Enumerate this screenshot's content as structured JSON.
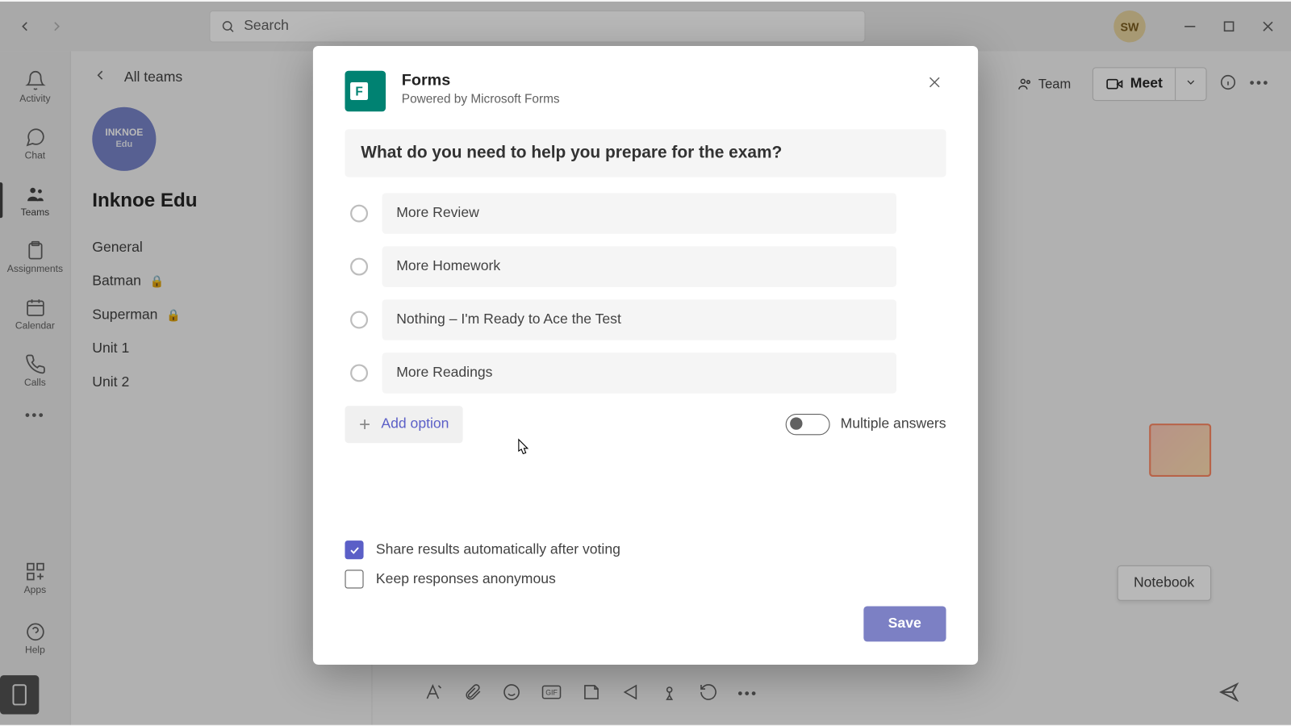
{
  "titlebar": {
    "search_placeholder": "Search",
    "avatar_initials": "SW"
  },
  "rail": {
    "activity": "Activity",
    "chat": "Chat",
    "teams": "Teams",
    "assignments": "Assignments",
    "calendar": "Calendar",
    "calls": "Calls",
    "apps": "Apps",
    "help": "Help"
  },
  "channels": {
    "back_label": "All teams",
    "team_logo_top": "INKNOE",
    "team_logo_sub": "Edu",
    "team_name": "Inknoe Edu",
    "items": [
      {
        "label": "General",
        "locked": false
      },
      {
        "label": "Batman",
        "locked": true
      },
      {
        "label": "Superman",
        "locked": true
      },
      {
        "label": "Unit 1",
        "locked": false
      },
      {
        "label": "Unit 2",
        "locked": false
      }
    ]
  },
  "header": {
    "team_btn": "Team",
    "meet_btn": "Meet"
  },
  "content": {
    "notebook_chip": "Notebook"
  },
  "modal": {
    "title": "Forms",
    "subtitle": "Powered by Microsoft Forms",
    "question": "What do you need to help you prepare for the exam?",
    "options": [
      "More Review",
      "More Homework",
      "Nothing – I'm Ready to Ace the Test",
      "More Readings"
    ],
    "add_option_label": "Add option",
    "multiple_answers_label": "Multiple answers",
    "share_results_label": "Share results automatically after voting",
    "anonymous_label": "Keep responses anonymous",
    "save_label": "Save",
    "share_results_checked": true,
    "anonymous_checked": false
  }
}
